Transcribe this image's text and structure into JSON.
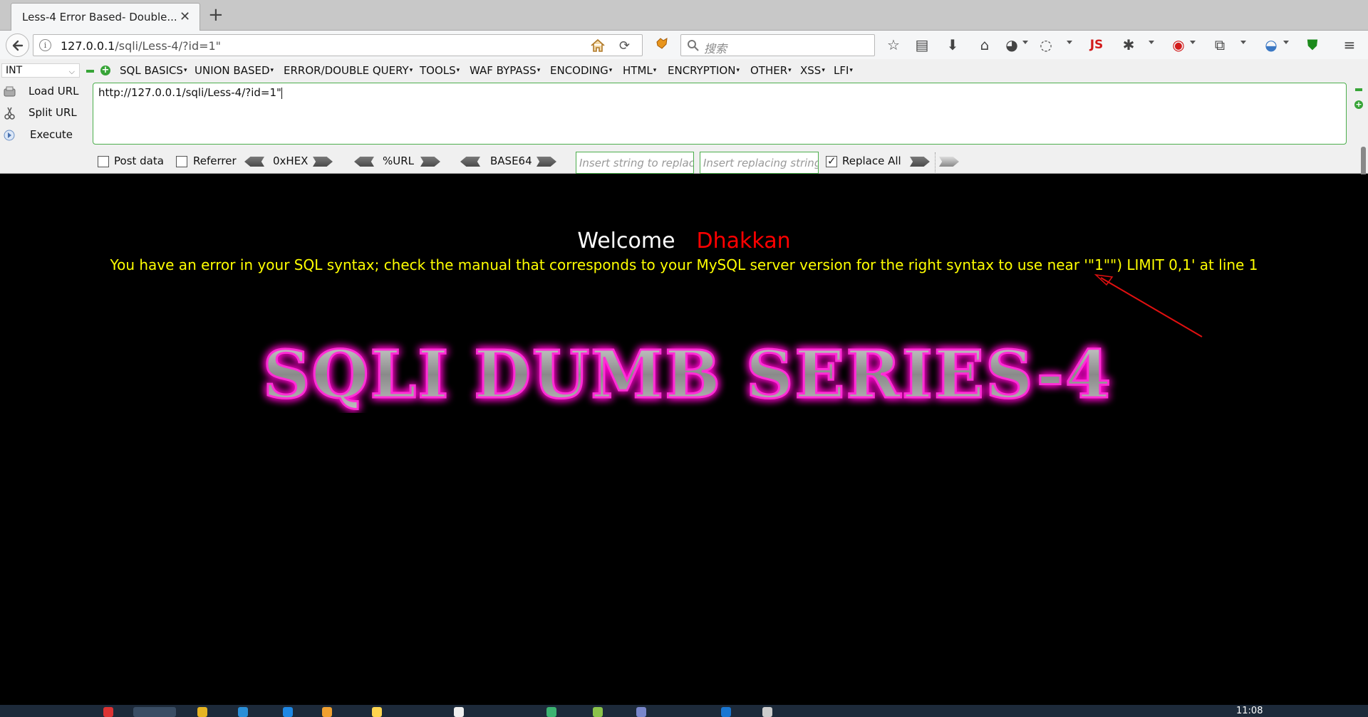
{
  "browser": {
    "tab": {
      "title": "Less-4 Error Based- Double...",
      "close": "✕",
      "new_tab": "+"
    },
    "url": {
      "host": "127.0.0.1",
      "path": "/sqli/Less-4/?id=1\""
    },
    "search": {
      "placeholder": "搜索"
    },
    "icons": [
      "back-icon",
      "info-icon",
      "home-icon",
      "reload-icon",
      "fox-icon",
      "search-icon",
      "star-icon",
      "reading-list-icon",
      "download-icon",
      "home-icon",
      "globe-icon",
      "palette-icon",
      "js-icon",
      "bug-icon",
      "shield-icon",
      "menu-icon"
    ],
    "js_label": "JS"
  },
  "hackbar": {
    "select_value": "INT",
    "menus": [
      "SQL BASICS",
      "UNION BASED",
      "ERROR/DOUBLE QUERY",
      "TOOLS",
      "WAF BYPASS",
      "ENCODING",
      "HTML",
      "ENCRYPTION",
      "OTHER",
      "XSS",
      "LFI"
    ],
    "actions": {
      "load": "Load URL",
      "split": "Split URL",
      "execute": "Execute"
    },
    "textarea_value": "http://127.0.0.1/sqli/Less-4/?id=1\"",
    "post_data": "Post data",
    "referrer": "Referrer",
    "hex": "0xHEX",
    "url_enc": "%URL",
    "base64": "BASE64",
    "replace_from_placeholder": "Insert string to replace",
    "replace_to_placeholder": "Insert replacing string",
    "replace_all": "Replace All",
    "replace_all_checked": true
  },
  "page": {
    "welcome": "Welcome",
    "name": "Dhakkan",
    "error": "You have an error in your SQL syntax; check the manual that corresponds to your MySQL server version for the right syntax to use near '\"1\"\") LIMIT 0,1' at line 1",
    "banner": "SQLI DUMB SERIES-4",
    "colors": {
      "welcome": "#ffffff",
      "name": "#ff0000",
      "error": "#ffff00",
      "banner_glow": "#ff00cc",
      "annotation": "#e01010"
    }
  },
  "taskbar": {
    "clock": "11:08"
  }
}
